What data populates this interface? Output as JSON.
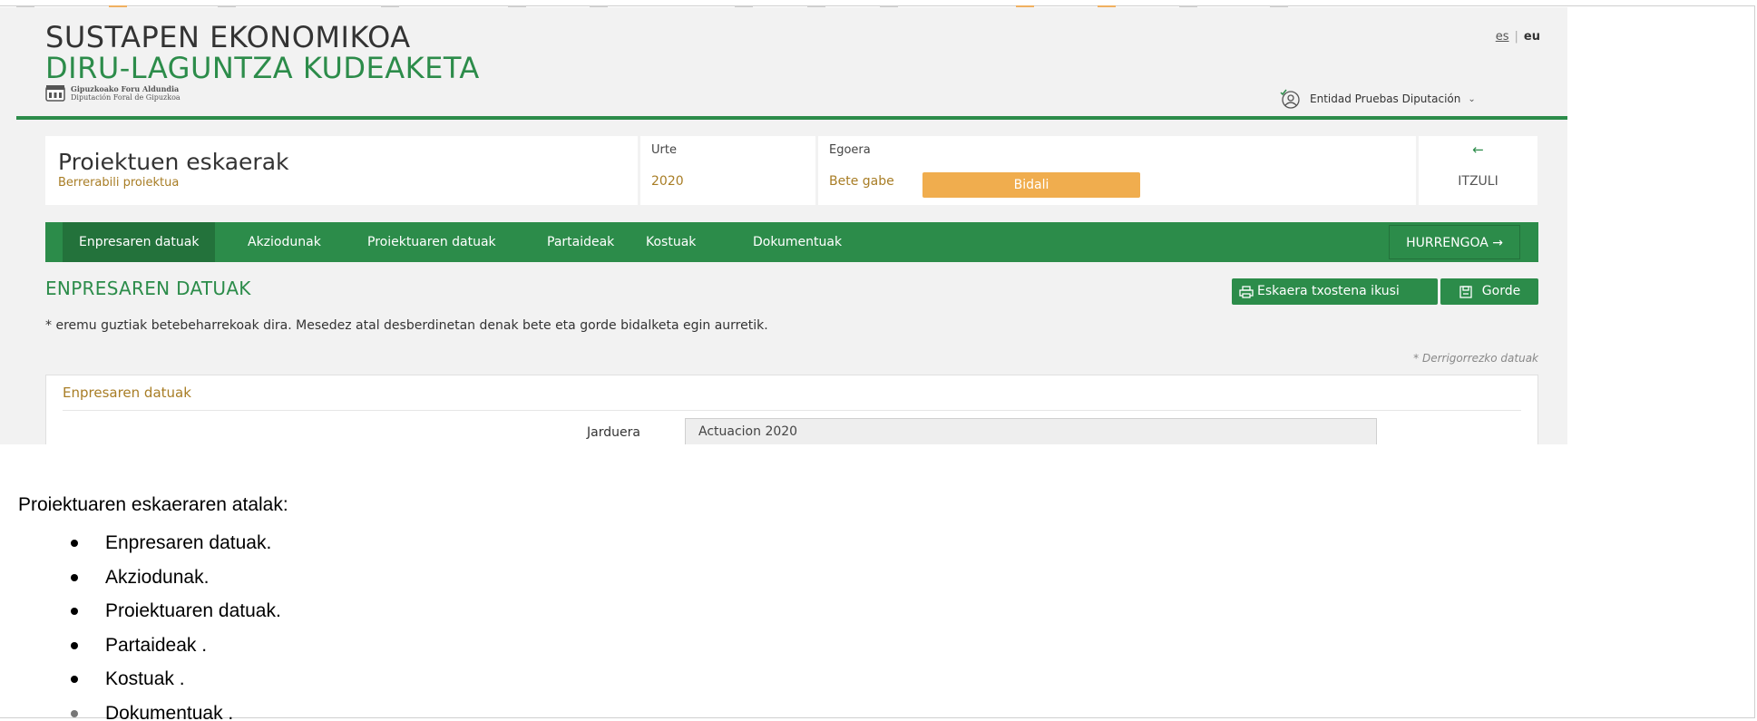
{
  "header": {
    "title_line1": "SUSTAPEN EKONOMIKOA",
    "title_line2": "DIRU-LAGUNTZA KUDEAKETA",
    "logo_line1": "Gipuzkoako Foru Aldundia",
    "logo_line2": "Diputación Foral de Gipuzkoa",
    "lang_es": "es",
    "lang_sep": "|",
    "lang_eu": "eu",
    "user_name": "Entidad Pruebas Diputación",
    "user_caret": "⌄"
  },
  "card": {
    "title": "Proiektuen eskaerak",
    "subtitle": "Berrerabili proiektua",
    "year_label": "Urte",
    "year_value": "2020",
    "state_label": "Egoera",
    "state_value": "Bete gabe",
    "send_button": "Bidali",
    "back_arrow": "←",
    "back_label": "ITZULI"
  },
  "nav": {
    "tabs": [
      "Enpresaren datuak",
      "Akziodunak",
      "Proiektuaren datuak",
      "Partaideak",
      "Kostuak",
      "Dokumentuak"
    ],
    "next_label": "HURRENGOA →"
  },
  "section": {
    "title": "ENPRESAREN DATUAK",
    "report_button": "Eskaera txostena ikusi",
    "save_button": "Gorde",
    "note": "* eremu guztiak betebeharrekoak dira. Mesedez atal desberdinetan denak bete eta gorde bidalketa egin aurretik.",
    "required_note": "* Derrigorrezko datuak",
    "panel_title": "Enpresaren datuak",
    "field_label": "Jarduera",
    "field_value": "Actuacion 2020"
  },
  "doc": {
    "intro": "Proiektuaren eskaeraren atalak:",
    "items": [
      "Enpresaren datuak.",
      "Akziodunak.",
      "Proiektuaren datuak.",
      "Partaideak .",
      "Kostuak .",
      "Dokumentuak ."
    ]
  },
  "colors": {
    "brand_green": "#2c8c4a",
    "accent_gold": "#a87d25",
    "send_orange": "#f0ad4e"
  }
}
